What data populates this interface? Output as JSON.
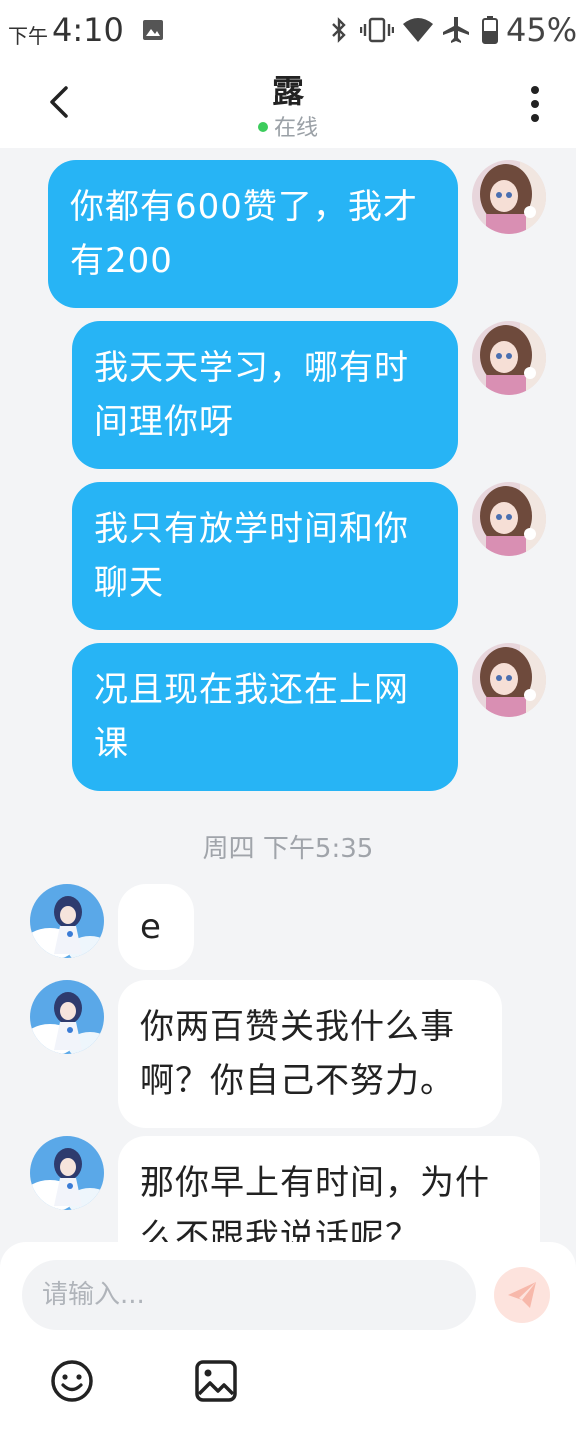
{
  "status_bar": {
    "ampm": "下午",
    "time": "4:10",
    "battery_percent": "45%",
    "icons": [
      "image-icon",
      "bluetooth-icon",
      "vibrate-icon",
      "wifi-icon",
      "airplane-icon",
      "battery-icon"
    ]
  },
  "header": {
    "contact_name": "露",
    "online_status": "在线",
    "online_color": "#3ccc5c"
  },
  "messages_me": [
    {
      "line1": "你都有600赞了，我才",
      "line2": "有200"
    },
    {
      "line1": "我天天学习，哪有时",
      "line2": "间理你呀"
    },
    {
      "line1": "我只有放学时间和你",
      "line2": "聊天"
    },
    {
      "line1": "况且现在我还在上网",
      "line2": "课"
    }
  ],
  "timestamp": "周四 下午5:35",
  "messages_them": [
    {
      "line1": "e",
      "line2": ""
    },
    {
      "line1": "你两百赞关我什么事",
      "line2": "啊？你自己不努力。"
    },
    {
      "line1": "那你早上有时间，为什",
      "line2": "么不跟我说话呢？"
    }
  ],
  "input": {
    "placeholder": "请输入..."
  },
  "colors": {
    "my_bubble": "#27b4f5",
    "their_bubble": "#ffffff",
    "background": "#f3f4f6"
  }
}
